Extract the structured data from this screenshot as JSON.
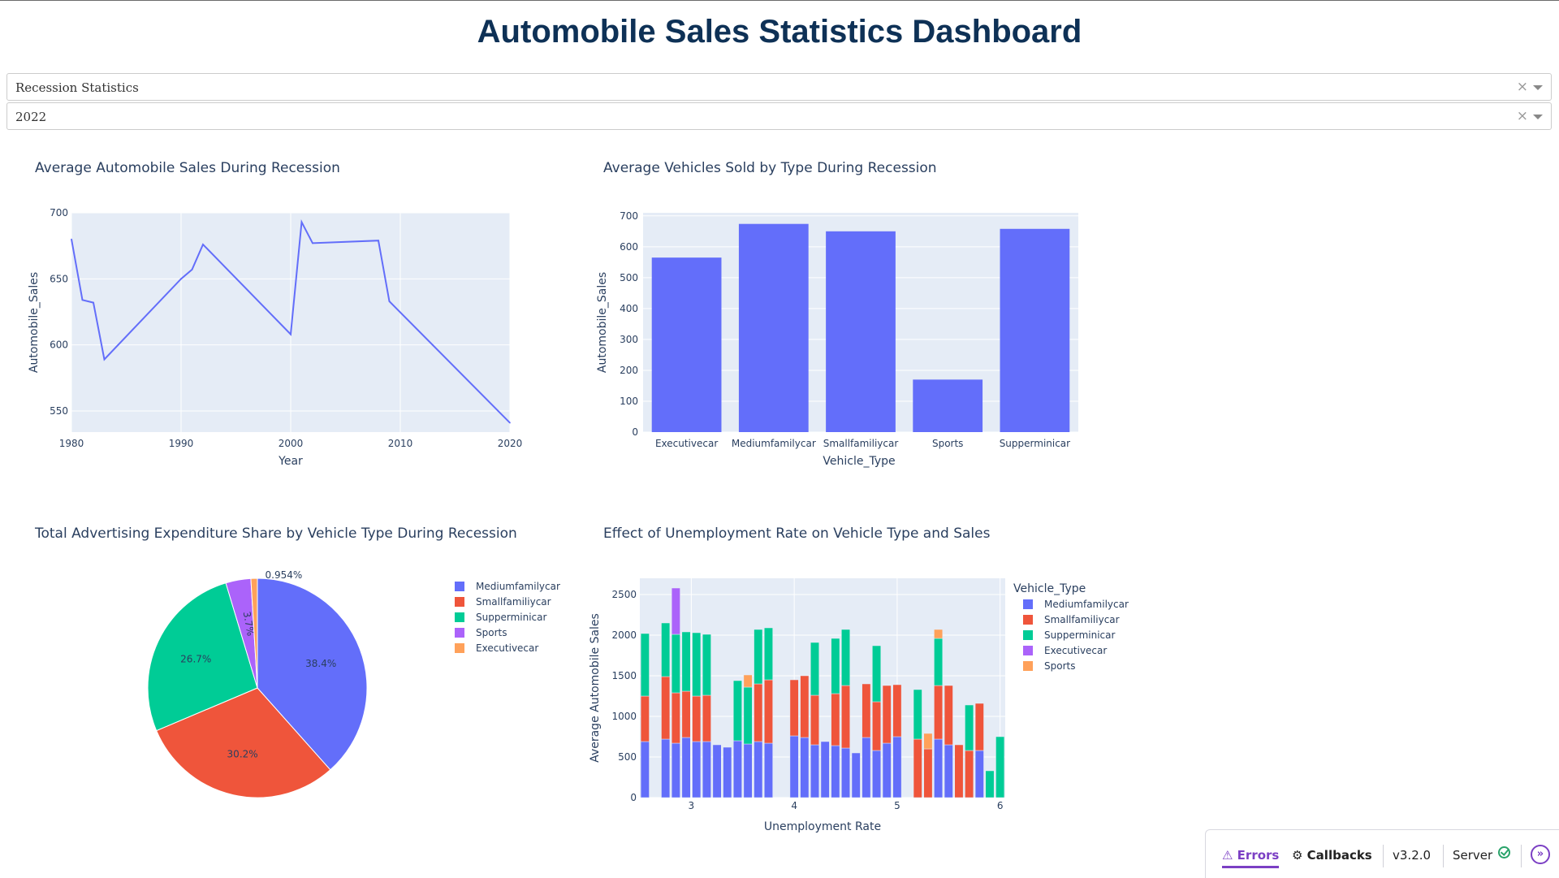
{
  "page": {
    "title": "Automobile Sales Statistics Dashboard"
  },
  "dropdowns": {
    "statistics": {
      "value": "Recession Statistics",
      "clear_icon": "clear-icon",
      "arrow_icon": "caret-down-icon"
    },
    "year": {
      "value": "2022",
      "clear_icon": "clear-icon",
      "arrow_icon": "caret-down-icon"
    }
  },
  "colors": {
    "plot_bg": "#e5ecf6",
    "series": [
      "#636efa",
      "#ef553b",
      "#00cc96",
      "#ab63fa",
      "#ffa15a"
    ],
    "title": "#0e3156"
  },
  "chart_data": [
    {
      "id": "line",
      "type": "line",
      "title": "Average Automobile Sales During Recession",
      "xlabel": "Year",
      "ylabel": "Automobile_Sales",
      "xlim": [
        1980,
        2020
      ],
      "ylim": [
        534,
        700
      ],
      "xticks": [
        "1980",
        "1990",
        "2000",
        "2010",
        "2020"
      ],
      "yticks": [
        "550",
        "600",
        "650",
        "700"
      ],
      "grid": true,
      "x": [
        1980,
        1981,
        1982,
        1983,
        1990,
        1991,
        1992,
        2000,
        2001,
        2002,
        2008,
        2009,
        2020
      ],
      "y": [
        680,
        634,
        632,
        589,
        650,
        657,
        676,
        608,
        693,
        677,
        679,
        633,
        541
      ]
    },
    {
      "id": "bar",
      "type": "bar",
      "title": "Average Vehicles Sold by Type During Recession",
      "xlabel": "Vehicle_Type",
      "ylabel": "Automobile_Sales",
      "ylim": [
        0,
        710
      ],
      "yticks": [
        "0",
        "100",
        "200",
        "300",
        "400",
        "500",
        "600",
        "700"
      ],
      "grid": true,
      "categories": [
        "Executivecar",
        "Mediumfamilycar",
        "Smallfamiliycar",
        "Sports",
        "Supperminicar"
      ],
      "values": [
        565,
        674,
        650,
        170,
        658
      ]
    },
    {
      "id": "pie",
      "type": "pie",
      "title": "Total Advertising Expenditure Share by Vehicle Type During Recession",
      "legend_position": "right",
      "categories": [
        "Mediumfamilycar",
        "Smallfamiliycar",
        "Supperminicar",
        "Sports",
        "Executivecar"
      ],
      "values": [
        38.4,
        30.2,
        26.7,
        3.7,
        0.954
      ],
      "labels": [
        "38.4%",
        "30.2%",
        "26.7%",
        "3.7%",
        "0.954%"
      ]
    },
    {
      "id": "stacked",
      "type": "bar",
      "title": "Effect of Unemployment Rate on Vehicle Type and Sales",
      "xlabel": "Unemployment Rate",
      "ylabel": "Average Automobile Sales",
      "legend_title": "Vehicle_Type",
      "legend_position": "right",
      "xlim": [
        2.5,
        6.05
      ],
      "ylim": [
        0,
        2700
      ],
      "xticks": [
        "3",
        "4",
        "5",
        "6"
      ],
      "xtick_values": [
        3,
        4,
        5,
        6
      ],
      "yticks": [
        "0",
        "500",
        "1000",
        "1500",
        "2000",
        "2500"
      ],
      "ytick_values": [
        0,
        500,
        1000,
        1500,
        2000,
        2500
      ],
      "bar_width": 0.082,
      "series_names": [
        "Mediumfamilycar",
        "Smallfamiliycar",
        "Supperminicar",
        "Executivecar",
        "Sports"
      ],
      "bars": [
        {
          "x": 2.55,
          "v": [
            690,
            560,
            770,
            0,
            0
          ]
        },
        {
          "x": 2.75,
          "v": [
            720,
            770,
            660,
            0,
            0
          ]
        },
        {
          "x": 2.85,
          "v": [
            670,
            620,
            720,
            570,
            0
          ]
        },
        {
          "x": 2.95,
          "v": [
            740,
            570,
            730,
            0,
            0
          ]
        },
        {
          "x": 3.05,
          "v": [
            690,
            560,
            780,
            0,
            0
          ]
        },
        {
          "x": 3.15,
          "v": [
            690,
            570,
            750,
            0,
            0
          ]
        },
        {
          "x": 3.25,
          "v": [
            650,
            0,
            0,
            0,
            0
          ]
        },
        {
          "x": 3.35,
          "v": [
            620,
            0,
            0,
            0,
            0
          ]
        },
        {
          "x": 3.45,
          "v": [
            700,
            0,
            740,
            0,
            0
          ]
        },
        {
          "x": 3.55,
          "v": [
            660,
            0,
            700,
            0,
            150
          ]
        },
        {
          "x": 3.65,
          "v": [
            690,
            710,
            670,
            0,
            0
          ]
        },
        {
          "x": 3.75,
          "v": [
            670,
            780,
            640,
            0,
            0
          ]
        },
        {
          "x": 4.0,
          "v": [
            760,
            690,
            0,
            0,
            0
          ]
        },
        {
          "x": 4.1,
          "v": [
            740,
            760,
            0,
            0,
            0
          ]
        },
        {
          "x": 4.2,
          "v": [
            650,
            610,
            650,
            0,
            0
          ]
        },
        {
          "x": 4.3,
          "v": [
            690,
            0,
            0,
            0,
            0
          ]
        },
        {
          "x": 4.4,
          "v": [
            640,
            640,
            680,
            0,
            0
          ]
        },
        {
          "x": 4.5,
          "v": [
            610,
            770,
            690,
            0,
            0
          ]
        },
        {
          "x": 4.6,
          "v": [
            550,
            0,
            0,
            0,
            0
          ]
        },
        {
          "x": 4.7,
          "v": [
            740,
            660,
            0,
            0,
            0
          ]
        },
        {
          "x": 4.8,
          "v": [
            580,
            600,
            690,
            0,
            0
          ]
        },
        {
          "x": 4.9,
          "v": [
            670,
            710,
            0,
            0,
            0
          ]
        },
        {
          "x": 5.0,
          "v": [
            750,
            640,
            0,
            0,
            0
          ]
        },
        {
          "x": 5.2,
          "v": [
            0,
            720,
            610,
            0,
            0
          ]
        },
        {
          "x": 5.3,
          "v": [
            0,
            600,
            0,
            0,
            190
          ]
        },
        {
          "x": 5.4,
          "v": [
            720,
            660,
            580,
            0,
            110
          ]
        },
        {
          "x": 5.5,
          "v": [
            650,
            730,
            0,
            0,
            0
          ]
        },
        {
          "x": 5.6,
          "v": [
            0,
            650,
            0,
            0,
            0
          ]
        },
        {
          "x": 5.7,
          "v": [
            0,
            580,
            560,
            0,
            0
          ]
        },
        {
          "x": 5.8,
          "v": [
            580,
            580,
            0,
            0,
            0
          ]
        },
        {
          "x": 5.9,
          "v": [
            0,
            0,
            330,
            0,
            0
          ]
        },
        {
          "x": 6.0,
          "v": [
            0,
            0,
            750,
            0,
            0
          ]
        }
      ]
    }
  ],
  "debug_bar": {
    "errors_label": "Errors",
    "errors_icon": "warning-triangle-icon",
    "callbacks_label": "Callbacks",
    "callbacks_icon": "callbacks-icon",
    "version": "v3.2.0",
    "server_label": "Server",
    "server_icon": "check-circle-icon",
    "expand_icon": "expand-chevrons-icon"
  }
}
